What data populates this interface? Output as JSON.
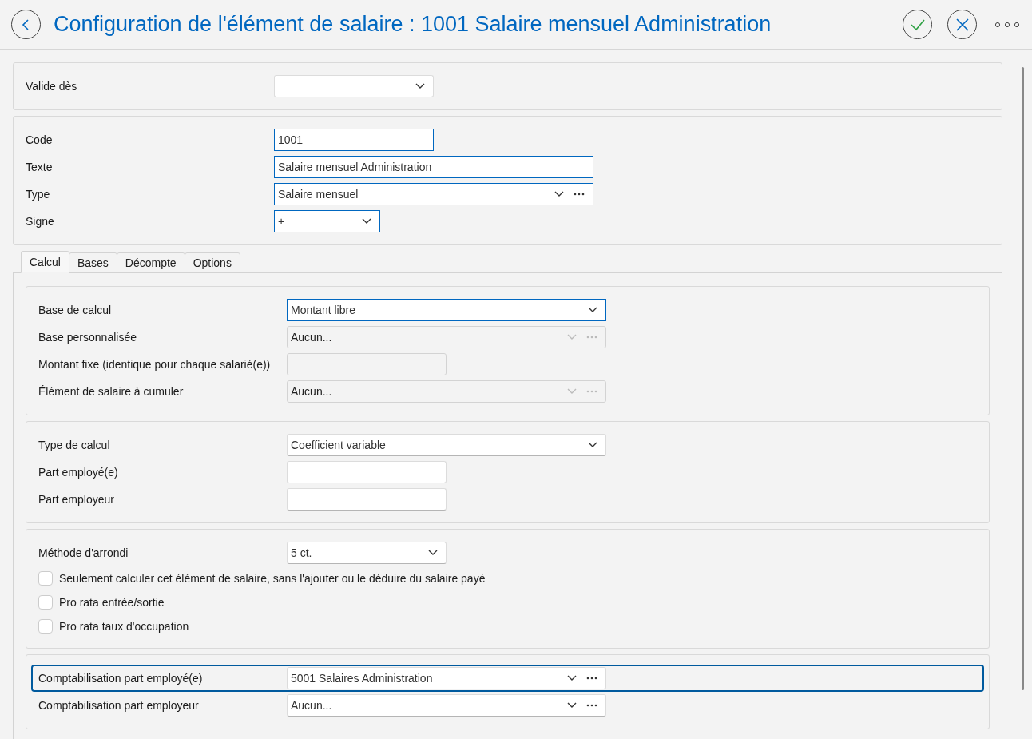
{
  "header": {
    "title": "Configuration de l'élément de salaire : 1001 Salaire mensuel Administration"
  },
  "sections": [
    {
      "fields": [
        {
          "label": "Valide dès",
          "kind": "short-select",
          "focused": false,
          "disabled": false
        }
      ]
    },
    {
      "fields": [
        {
          "label": "Code",
          "kind": "input",
          "value": "1001",
          "focused": true,
          "disabled": false
        },
        {
          "label": "Texte",
          "kind": "wide-input",
          "value": "Salaire mensuel Administration",
          "focused": true,
          "disabled": false
        },
        {
          "label": "Type",
          "kind": "lookup",
          "value": "Salaire mensuel",
          "focused": true,
          "disabled": false
        },
        {
          "label": "Signe",
          "kind": "tiny-select",
          "value": "+",
          "focused": true,
          "disabled": false
        }
      ]
    }
  ],
  "tabs": [
    {
      "label": "Calcul",
      "selected": true
    },
    {
      "label": "Bases",
      "selected": false
    },
    {
      "label": "Décompte",
      "selected": false
    },
    {
      "label": "Options",
      "selected": false
    }
  ],
  "groups": [
    {
      "fields": [
        {
          "label": "Base de calcul",
          "kind": "select",
          "value": "Montant libre",
          "focused": true,
          "disabled": false,
          "selected": false
        },
        {
          "label": "Base personnalisée",
          "kind": "lookup",
          "value": "Aucun...",
          "focused": false,
          "disabled": true,
          "selected": false
        },
        {
          "label": "Montant fixe (identique pour chaque salarié(e))",
          "kind": "input",
          "focused": false,
          "disabled": true,
          "selected": false
        },
        {
          "label": "Élément de salaire à cumuler",
          "kind": "lookup",
          "value": "Aucun...",
          "focused": false,
          "disabled": true,
          "selected": false
        }
      ]
    },
    {
      "fields": [
        {
          "label": "Type de calcul",
          "kind": "select",
          "value": "Coefficient variable",
          "focused": false,
          "disabled": false,
          "selected": false
        },
        {
          "label": "Part employé(e)",
          "kind": "input",
          "focused": false,
          "disabled": false,
          "selected": false
        },
        {
          "label": "Part employeur",
          "kind": "input",
          "focused": false,
          "disabled": false,
          "selected": false
        }
      ]
    },
    {
      "fields": [
        {
          "label": "Méthode d'arrondi",
          "kind": "short-select",
          "value": "5 ct.",
          "focused": false,
          "disabled": false,
          "selected": false
        },
        {
          "label": "Seulement calculer cet élément de salaire, sans l'ajouter ou le déduire du salaire payé",
          "kind": "checkbox",
          "checked": false,
          "selected": false
        },
        {
          "label": "Pro rata entrée/sortie",
          "kind": "checkbox",
          "checked": false,
          "selected": false
        },
        {
          "label": "Pro rata taux d'occupation",
          "kind": "checkbox",
          "checked": false,
          "selected": false
        }
      ]
    },
    {
      "fields": [
        {
          "label": "Comptabilisation part employé(e)",
          "kind": "lookup",
          "value": "5001 Salaires Administration",
          "focused": false,
          "disabled": false,
          "selected": true
        },
        {
          "label": "Comptabilisation part employeur",
          "kind": "lookup",
          "value": "Aucun...",
          "focused": false,
          "disabled": false,
          "selected": false
        }
      ]
    }
  ]
}
